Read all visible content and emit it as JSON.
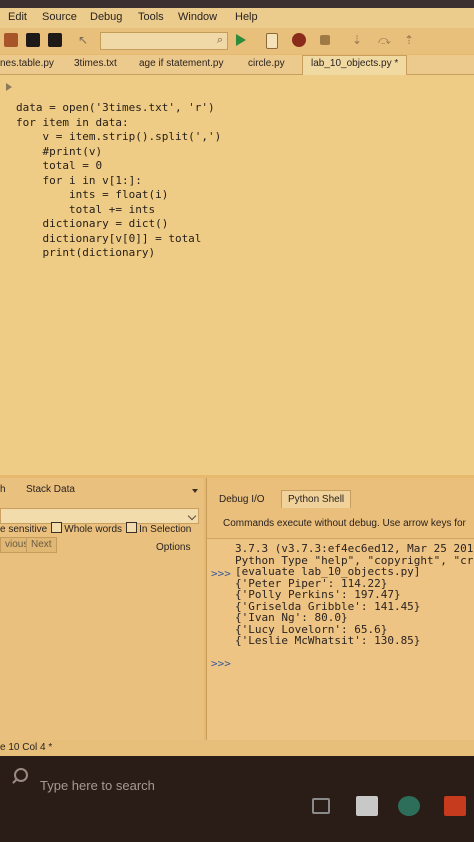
{
  "menu": {
    "items": [
      "Edit",
      "Source",
      "Debug",
      "Tools",
      "Window",
      "Help"
    ]
  },
  "toolbar": {
    "icons": [
      "open-folder-icon",
      "save-icon",
      "save-all-icon",
      "pointer-icon",
      "search-icon",
      "run-icon",
      "new-file-icon",
      "debug-bug-icon",
      "stop-icon",
      "step-into-icon",
      "step-over-icon",
      "step-out-icon"
    ],
    "search_value": "",
    "colors": {
      "run": "#2e8b3a",
      "bug": "#8a2b1c",
      "folder": "#a8552a"
    }
  },
  "tabs": [
    {
      "label": "nes.table.py",
      "active": false
    },
    {
      "label": "3times.txt",
      "active": false
    },
    {
      "label": "age if statement.py",
      "active": false
    },
    {
      "label": "circle.py",
      "active": false
    },
    {
      "label": "lab_10_objects.py *",
      "active": true
    }
  ],
  "editor": {
    "lines": [
      "data = open('3times.txt', 'r')",
      "for item in data:",
      "    v = item.strip().split(',')",
      "    #print(v)",
      "    total = 0",
      "    for i in v[1:]:",
      "        ints = float(i)",
      "        total += ints",
      "    dictionary = dict()",
      "    dictionary[v[0]] = total",
      "    print(dictionary)"
    ]
  },
  "search_panel": {
    "tab_label": "Stack Data",
    "tab_prefix": "h",
    "find_value": "",
    "case_label": "e sensitive",
    "whole_words_label": "Whole words",
    "in_selection_label": "In Selection",
    "prev_label": "vious",
    "next_label": "Next",
    "options_label": "Options"
  },
  "shell_panel": {
    "tabs": [
      "Debug I/O",
      "Python Shell"
    ],
    "active_tab": "Python Shell",
    "hint": "Commands execute without debug.  Use arrow keys for",
    "prompt": ">>>",
    "lines": [
      "3.7.3 (v3.7.3:ef4ec6ed12, Mar 25 201",
      "Python Type \"help\", \"copyright\", \"cr",
      "[evaluate lab_10_objects.py]",
      "{'Peter Piper': 114.22}",
      "{'Polly Perkins': 197.47}",
      "{'Griselda Gribble': 141.45}",
      "{'Ivan Ng': 80.0}",
      "{'Lucy Lovelorn': 65.6}",
      "{'Leslie McWhatsit': 130.85}"
    ]
  },
  "status": {
    "text": "e 10 Col 4 *"
  },
  "taskbar": {
    "search_placeholder": "Type here to search",
    "icons": [
      "task-view-icon",
      "store-icon",
      "edge-icon",
      "office-icon"
    ]
  }
}
